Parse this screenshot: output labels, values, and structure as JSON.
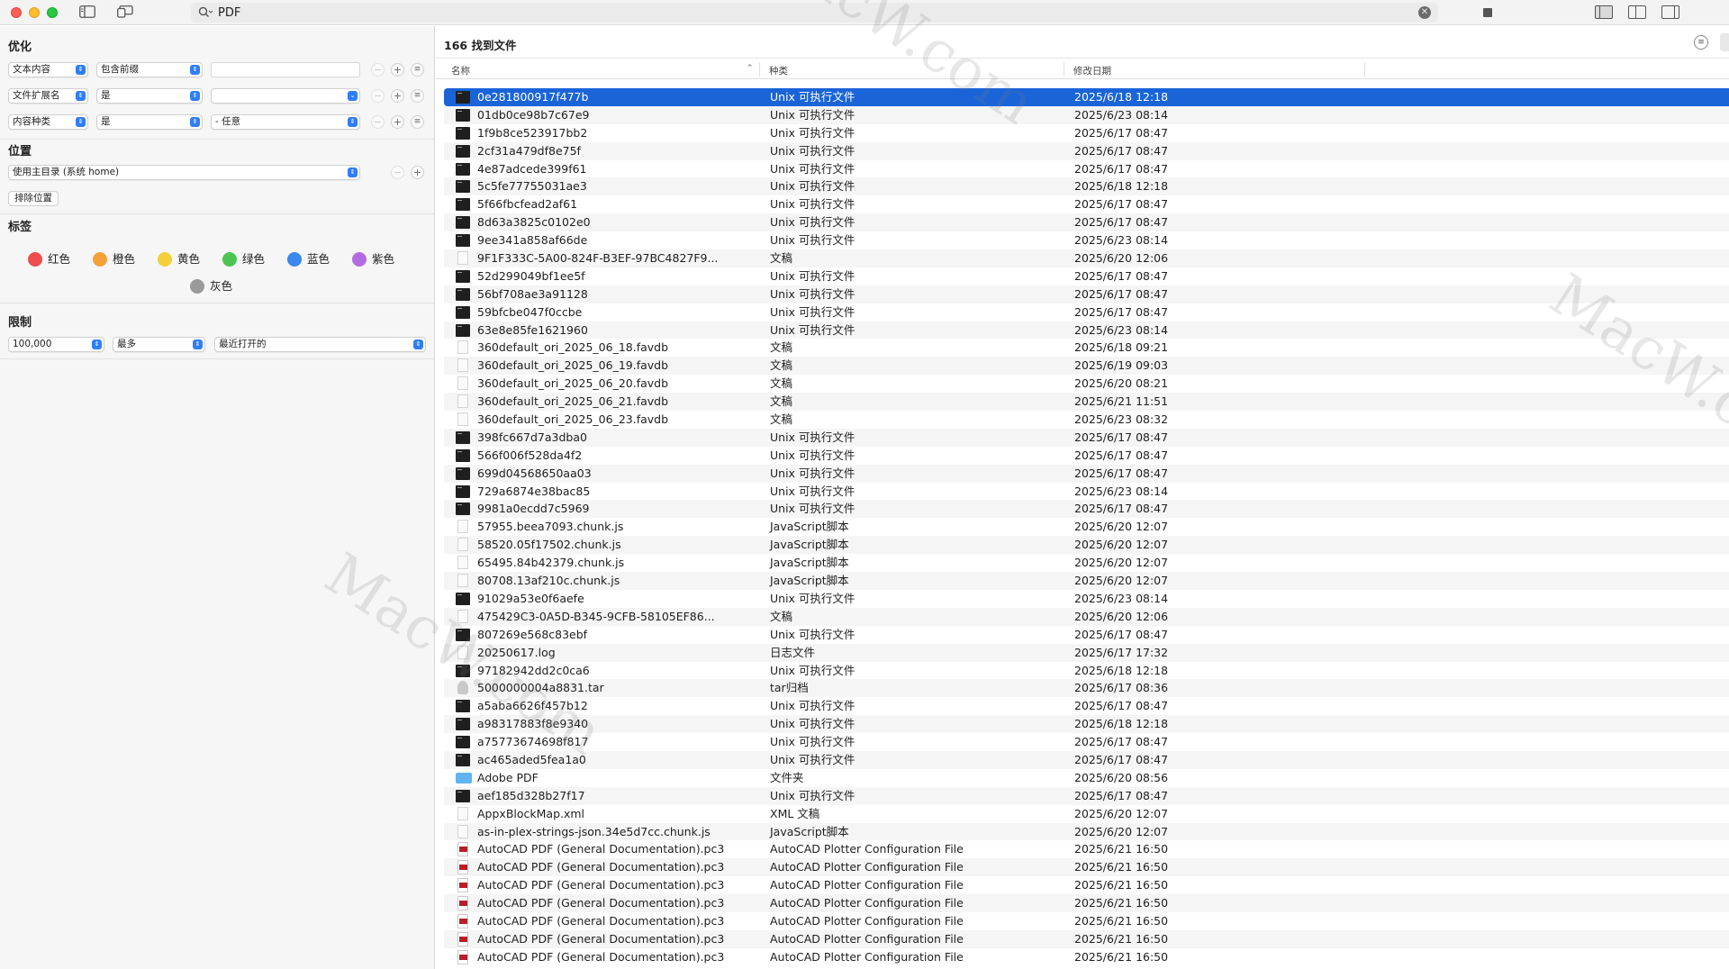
{
  "toolbar": {
    "search_query": "PDF"
  },
  "sidebar": {
    "optimize": {
      "title": "优化",
      "rows": [
        {
          "attribute": "文本内容",
          "operator": "包含前缀",
          "value": ""
        },
        {
          "attribute": "文件扩展名",
          "operator": "是",
          "value": ""
        },
        {
          "attribute": "内容种类",
          "operator": "是",
          "value": "- 任意"
        }
      ]
    },
    "location": {
      "title": "位置",
      "scope": "使用主目录 (系统 home)",
      "exclude_button": "排除位置"
    },
    "tags": {
      "title": "标签",
      "items": [
        {
          "label": "红色",
          "color": "#ee4d4d"
        },
        {
          "label": "橙色",
          "color": "#f5a139"
        },
        {
          "label": "黄色",
          "color": "#f5cf3a"
        },
        {
          "label": "绿色",
          "color": "#4cc452"
        },
        {
          "label": "蓝色",
          "color": "#3b86ef"
        },
        {
          "label": "紫色",
          "color": "#b36ce0"
        },
        {
          "label": "灰色",
          "color": "#9a9a9a"
        }
      ]
    },
    "limit": {
      "title": "限制",
      "count": "100,000",
      "mode": "最多",
      "order": "最近打开的"
    }
  },
  "results": {
    "count_label": "166 找到文件",
    "columns": {
      "name": "名称",
      "kind": "种类",
      "date": "修改日期"
    },
    "files": [
      {
        "name": "0e281800917f477b",
        "kind": "Unix 可执行文件",
        "date": "2025/6/18 12:18",
        "icon": "exec",
        "selected": true
      },
      {
        "name": "01db0ce98b7c67e9",
        "kind": "Unix 可执行文件",
        "date": "2025/6/23 08:14",
        "icon": "exec"
      },
      {
        "name": "1f9b8ce523917bb2",
        "kind": "Unix 可执行文件",
        "date": "2025/6/17 08:47",
        "icon": "exec"
      },
      {
        "name": "2cf31a479df8e75f",
        "kind": "Unix 可执行文件",
        "date": "2025/6/17 08:47",
        "icon": "exec"
      },
      {
        "name": "4e87adcede399f61",
        "kind": "Unix 可执行文件",
        "date": "2025/6/17 08:47",
        "icon": "exec"
      },
      {
        "name": "5c5fe77755031ae3",
        "kind": "Unix 可执行文件",
        "date": "2025/6/18 12:18",
        "icon": "exec"
      },
      {
        "name": "5f66fbcfead2af61",
        "kind": "Unix 可执行文件",
        "date": "2025/6/17 08:47",
        "icon": "exec"
      },
      {
        "name": "8d63a3825c0102e0",
        "kind": "Unix 可执行文件",
        "date": "2025/6/17 08:47",
        "icon": "exec"
      },
      {
        "name": "9ee341a858af66de",
        "kind": "Unix 可执行文件",
        "date": "2025/6/23 08:14",
        "icon": "exec"
      },
      {
        "name": "9F1F333C-5A00-824F-B3EF-97BC4827F9...",
        "kind": "文稿",
        "date": "2025/6/20 12:06",
        "icon": "doc"
      },
      {
        "name": "52d299049bf1ee5f",
        "kind": "Unix 可执行文件",
        "date": "2025/6/17 08:47",
        "icon": "exec"
      },
      {
        "name": "56bf708ae3a91128",
        "kind": "Unix 可执行文件",
        "date": "2025/6/17 08:47",
        "icon": "exec"
      },
      {
        "name": "59bfcbe047f0ccbe",
        "kind": "Unix 可执行文件",
        "date": "2025/6/17 08:47",
        "icon": "exec"
      },
      {
        "name": "63e8e85fe1621960",
        "kind": "Unix 可执行文件",
        "date": "2025/6/23 08:14",
        "icon": "exec"
      },
      {
        "name": "360default_ori_2025_06_18.favdb",
        "kind": "文稿",
        "date": "2025/6/18 09:21",
        "icon": "doc"
      },
      {
        "name": "360default_ori_2025_06_19.favdb",
        "kind": "文稿",
        "date": "2025/6/19 09:03",
        "icon": "doc"
      },
      {
        "name": "360default_ori_2025_06_20.favdb",
        "kind": "文稿",
        "date": "2025/6/20 08:21",
        "icon": "doc"
      },
      {
        "name": "360default_ori_2025_06_21.favdb",
        "kind": "文稿",
        "date": "2025/6/21 11:51",
        "icon": "doc"
      },
      {
        "name": "360default_ori_2025_06_23.favdb",
        "kind": "文稿",
        "date": "2025/6/23 08:32",
        "icon": "doc"
      },
      {
        "name": "398fc667d7a3dba0",
        "kind": "Unix 可执行文件",
        "date": "2025/6/17 08:47",
        "icon": "exec"
      },
      {
        "name": "566f006f528da4f2",
        "kind": "Unix 可执行文件",
        "date": "2025/6/17 08:47",
        "icon": "exec"
      },
      {
        "name": "699d04568650aa03",
        "kind": "Unix 可执行文件",
        "date": "2025/6/17 08:47",
        "icon": "exec"
      },
      {
        "name": "729a6874e38bac85",
        "kind": "Unix 可执行文件",
        "date": "2025/6/23 08:14",
        "icon": "exec"
      },
      {
        "name": "9981a0ecdd7c5969",
        "kind": "Unix 可执行文件",
        "date": "2025/6/17 08:47",
        "icon": "exec"
      },
      {
        "name": "57955.beea7093.chunk.js",
        "kind": "JavaScript脚本",
        "date": "2025/6/20 12:07",
        "icon": "doc"
      },
      {
        "name": "58520.05f17502.chunk.js",
        "kind": "JavaScript脚本",
        "date": "2025/6/20 12:07",
        "icon": "doc"
      },
      {
        "name": "65495.84b42379.chunk.js",
        "kind": "JavaScript脚本",
        "date": "2025/6/20 12:07",
        "icon": "doc"
      },
      {
        "name": "80708.13af210c.chunk.js",
        "kind": "JavaScript脚本",
        "date": "2025/6/20 12:07",
        "icon": "doc"
      },
      {
        "name": "91029a53e0f6aefe",
        "kind": "Unix 可执行文件",
        "date": "2025/6/23 08:14",
        "icon": "exec"
      },
      {
        "name": "475429C3-0A5D-B345-9CFB-58105EF86...",
        "kind": "文稿",
        "date": "2025/6/20 12:06",
        "icon": "doc"
      },
      {
        "name": "807269e568c83ebf",
        "kind": "Unix 可执行文件",
        "date": "2025/6/17 08:47",
        "icon": "exec"
      },
      {
        "name": "20250617.log",
        "kind": "日志文件",
        "date": "2025/6/17 17:32",
        "icon": "doc"
      },
      {
        "name": "97182942dd2c0ca6",
        "kind": "Unix 可执行文件",
        "date": "2025/6/18 12:18",
        "icon": "exec"
      },
      {
        "name": "5000000004a8831.tar",
        "kind": "tar归档",
        "date": "2025/6/17 08:36",
        "icon": "tar"
      },
      {
        "name": "a5aba6626f457b12",
        "kind": "Unix 可执行文件",
        "date": "2025/6/17 08:47",
        "icon": "exec"
      },
      {
        "name": "a98317883f8e9340",
        "kind": "Unix 可执行文件",
        "date": "2025/6/18 12:18",
        "icon": "exec"
      },
      {
        "name": "a75773674698f817",
        "kind": "Unix 可执行文件",
        "date": "2025/6/17 08:47",
        "icon": "exec"
      },
      {
        "name": "ac465aded5fea1a0",
        "kind": "Unix 可执行文件",
        "date": "2025/6/17 08:47",
        "icon": "exec"
      },
      {
        "name": "Adobe PDF",
        "kind": "文件夹",
        "date": "2025/6/20 08:56",
        "icon": "folder"
      },
      {
        "name": "aef185d328b27f17",
        "kind": "Unix 可执行文件",
        "date": "2025/6/17 08:47",
        "icon": "exec"
      },
      {
        "name": "AppxBlockMap.xml",
        "kind": "XML 文稿",
        "date": "2025/6/20 12:07",
        "icon": "doc"
      },
      {
        "name": "as-in-plex-strings-json.34e5d7cc.chunk.js",
        "kind": "JavaScript脚本",
        "date": "2025/6/20 12:07",
        "icon": "doc"
      },
      {
        "name": "AutoCAD PDF (General Documentation).pc3",
        "kind": "AutoCAD Plotter Configuration File",
        "date": "2025/6/21 16:50",
        "icon": "pc3"
      },
      {
        "name": "AutoCAD PDF (General Documentation).pc3",
        "kind": "AutoCAD Plotter Configuration File",
        "date": "2025/6/21 16:50",
        "icon": "pc3"
      },
      {
        "name": "AutoCAD PDF (General Documentation).pc3",
        "kind": "AutoCAD Plotter Configuration File",
        "date": "2025/6/21 16:50",
        "icon": "pc3"
      },
      {
        "name": "AutoCAD PDF (General Documentation).pc3",
        "kind": "AutoCAD Plotter Configuration File",
        "date": "2025/6/21 16:50",
        "icon": "pc3"
      },
      {
        "name": "AutoCAD PDF (General Documentation).pc3",
        "kind": "AutoCAD Plotter Configuration File",
        "date": "2025/6/21 16:50",
        "icon": "pc3"
      },
      {
        "name": "AutoCAD PDF (General Documentation).pc3",
        "kind": "AutoCAD Plotter Configuration File",
        "date": "2025/6/21 16:50",
        "icon": "pc3"
      },
      {
        "name": "AutoCAD PDF (General Documentation).pc3",
        "kind": "AutoCAD Plotter Configuration File",
        "date": "2025/6/21 16:50",
        "icon": "pc3"
      }
    ]
  },
  "watermark": "MacW.com",
  "colors": {
    "selection": "#1a64d8",
    "accent": "#2f7ef6"
  }
}
